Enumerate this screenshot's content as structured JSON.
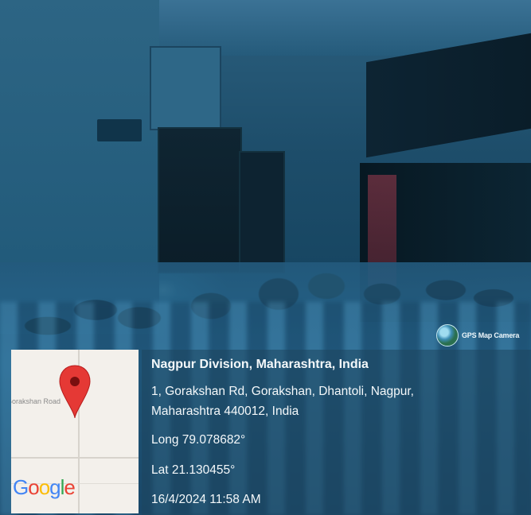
{
  "watermark": {
    "label": "GPS Map Camera"
  },
  "map": {
    "road_label": "Gorakshan Road",
    "logo": [
      "G",
      "o",
      "o",
      "g",
      "l",
      "e"
    ]
  },
  "location": {
    "title": "Nagpur Division, Maharashtra, India",
    "address_line1": "1, Gorakshan Rd, Gorakshan, Dhantoli, Nagpur,",
    "address_line2": "Maharashtra 440012, India",
    "longitude": "Long 79.078682°",
    "latitude": "Lat 21.130455°",
    "timestamp": "16/4/2024 11:58 AM"
  },
  "colors": {
    "pin": "#e53935",
    "panel": "#1e465f"
  }
}
